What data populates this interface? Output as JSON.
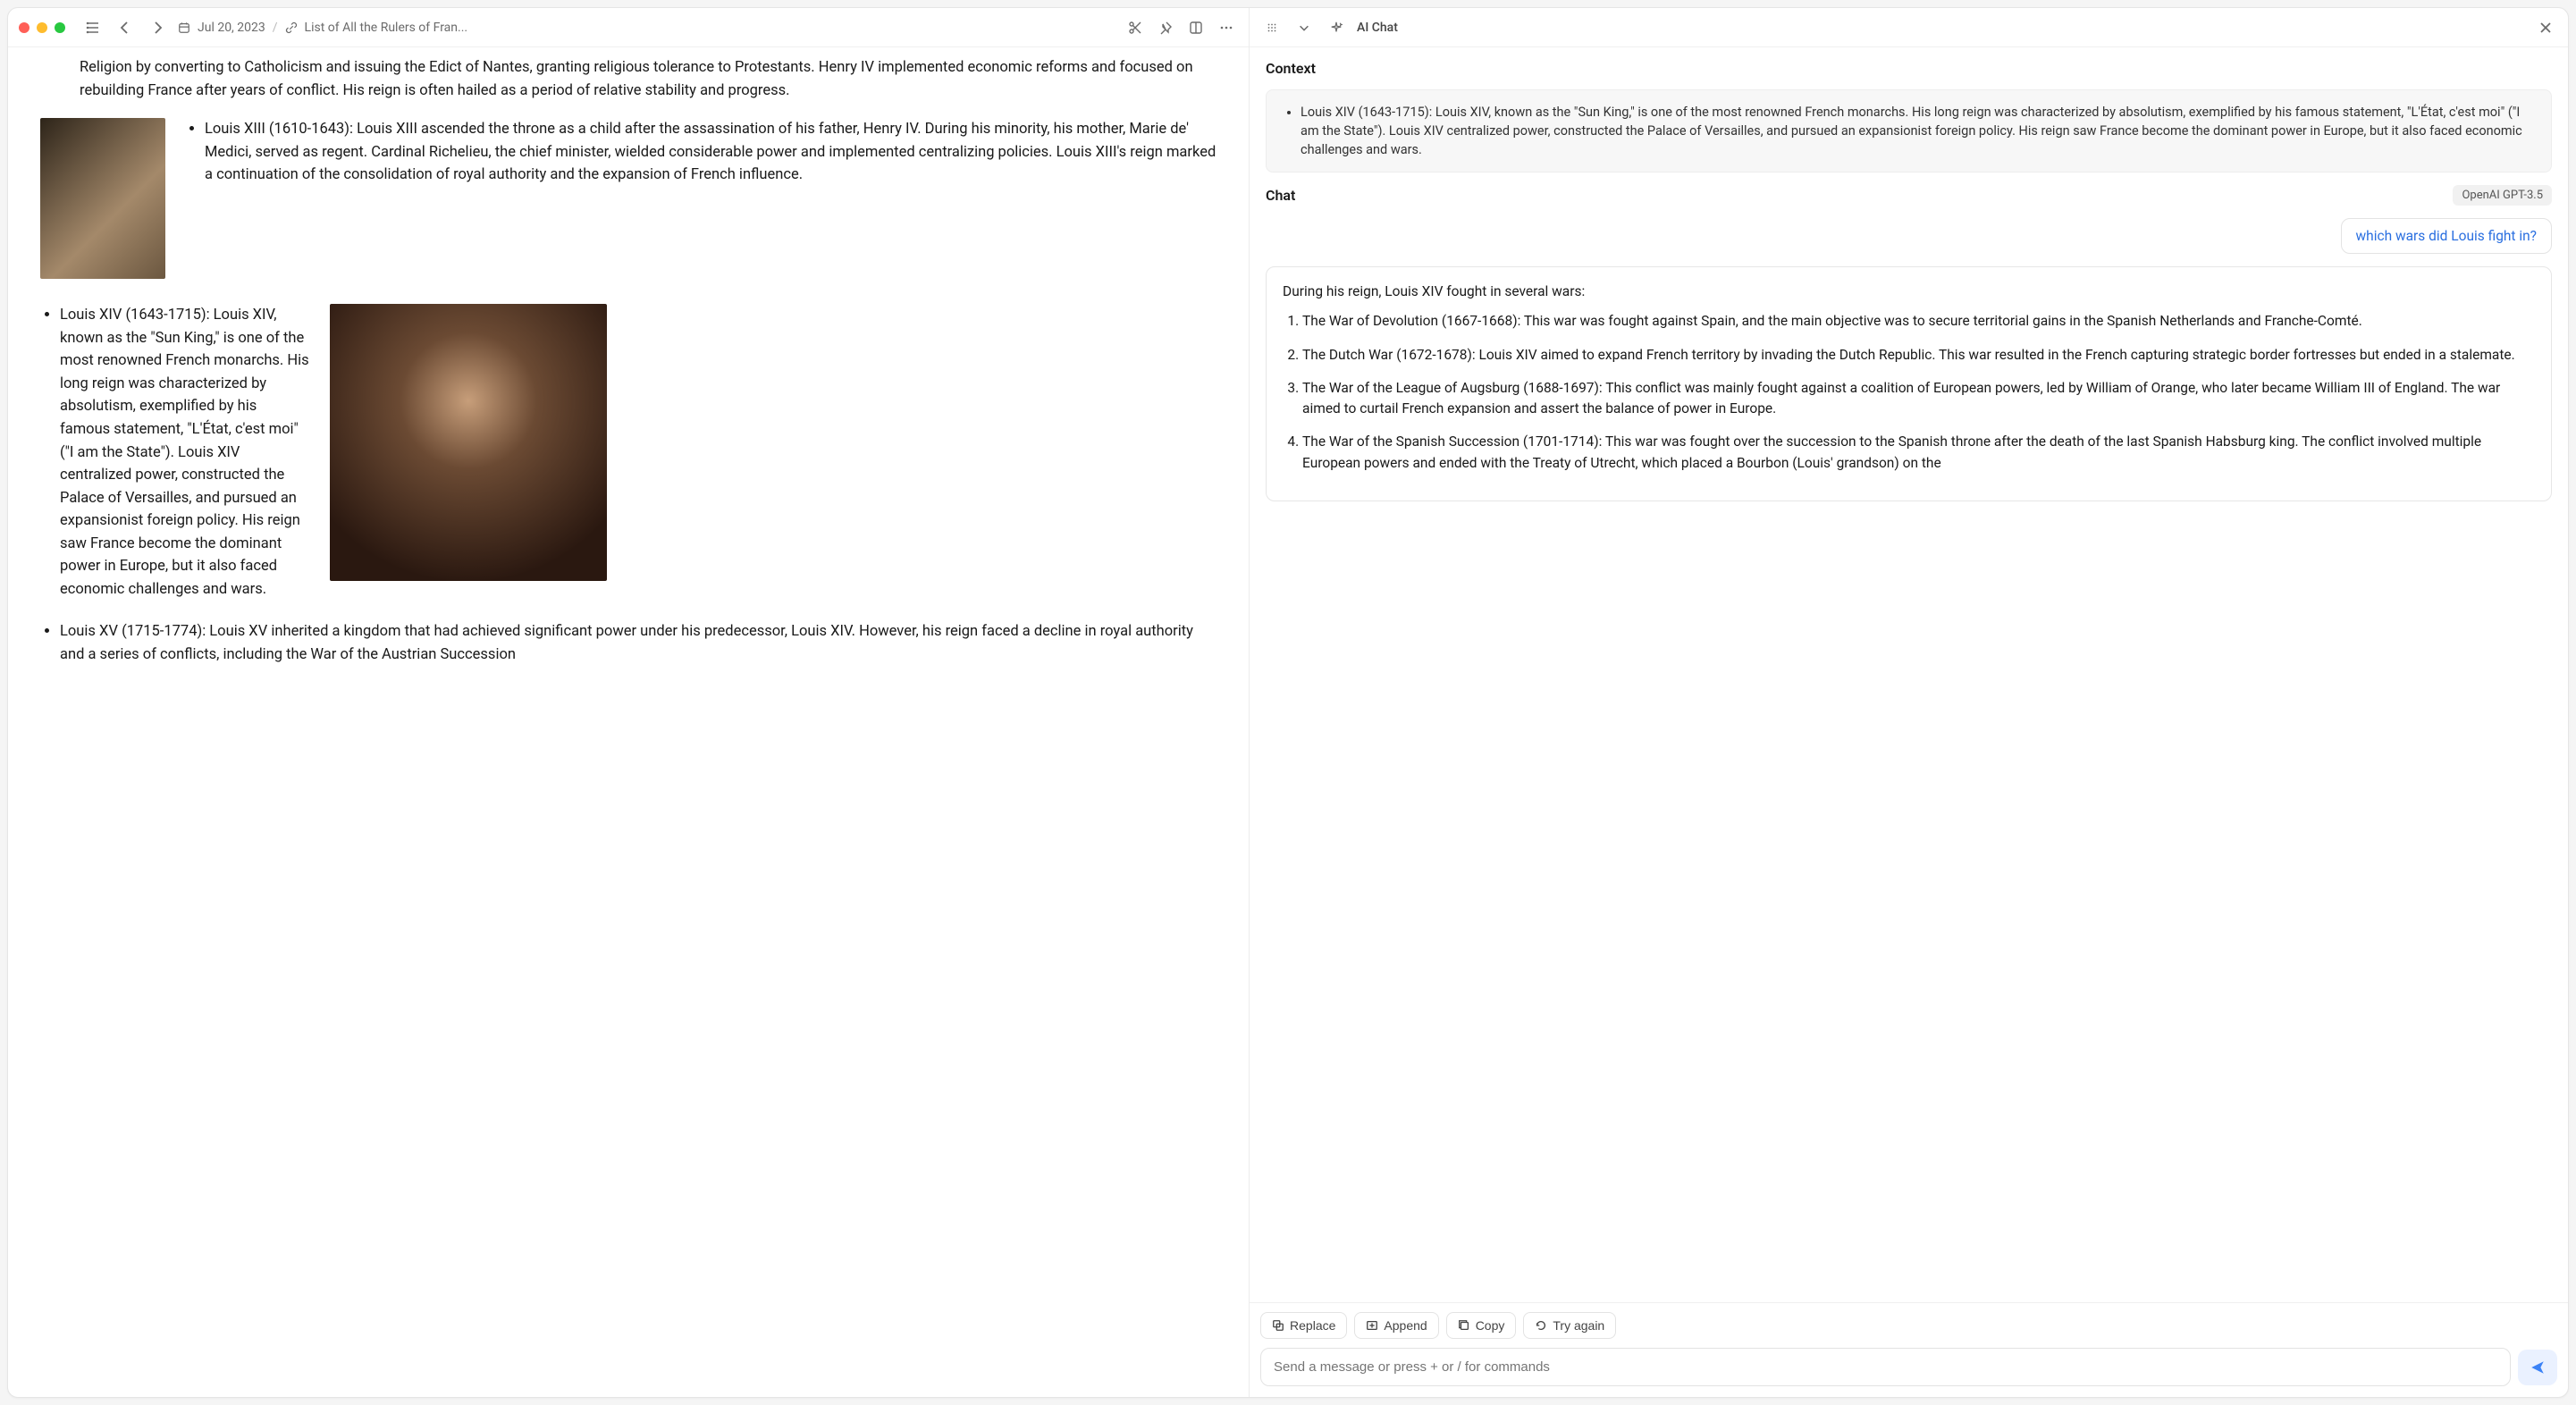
{
  "titlebar": {
    "date": "Jul 20, 2023",
    "doc_title": "List of All the Rulers of Fran..."
  },
  "document": {
    "intro_paragraph": "Religion by converting to Catholicism and issuing the Edict of Nantes, granting religious tolerance to Protestants. Henry IV implemented economic reforms and focused on rebuilding France after years of conflict. His reign is often hailed as a period of relative stability and progress.",
    "entries": {
      "louis_xiii": "Louis XIII (1610-1643): Louis XIII ascended the throne as a child after the assassination of his father, Henry IV. During his minority, his mother, Marie de' Medici, served as regent. Cardinal Richelieu, the chief minister, wielded considerable power and implemented centralizing policies. Louis XIII's reign marked a continuation of the consolidation of royal authority and the expansion of French influence.",
      "louis_xiv": "Louis XIV (1643-1715): Louis XIV, known as the \"Sun King,\" is one of the most renowned French monarchs. His long reign was characterized by absolutism, exemplified by his famous statement, \"L'État, c'est moi\" (\"I am the State\"). Louis XIV centralized power, constructed the Palace of Versailles, and pursued an expansionist foreign policy. His reign saw France become the dominant power in Europe, but it also faced economic challenges and wars.",
      "louis_xv": "Louis XV (1715-1774): Louis XV inherited a kingdom that had achieved significant power under his predecessor, Louis XIV. However, his reign faced a decline in royal authority and a series of conflicts, including the War of the Austrian Succession"
    }
  },
  "ai_panel": {
    "title": "AI Chat",
    "context_label": "Context",
    "context_text": "Louis XIV (1643-1715): Louis XIV, known as the \"Sun King,\" is one of the most renowned French monarchs. His long reign was characterized by absolutism, exemplified by his famous statement, \"L'État, c'est moi\" (\"I am the State\"). Louis XIV centralized power, constructed the Palace of Versailles, and pursued an expansionist foreign policy. His reign saw France become the dominant power in Europe, but it also faced economic challenges and wars.",
    "chat_label": "Chat",
    "model": "OpenAI GPT-3.5",
    "user_message": "which wars did Louis fight in?",
    "assistant_intro": "During his reign, Louis XIV fought in several wars:",
    "assistant_wars": [
      "The War of Devolution (1667-1668): This war was fought against Spain, and the main objective was to secure territorial gains in the Spanish Netherlands and Franche-Comté.",
      "The Dutch War (1672-1678): Louis XIV aimed to expand French territory by invading the Dutch Republic. This war resulted in the French capturing strategic border fortresses but ended in a stalemate.",
      "The War of the League of Augsburg (1688-1697): This conflict was mainly fought against a coalition of European powers, led by William of Orange, who later became William III of England. The war aimed to curtail French expansion and assert the balance of power in Europe.",
      "The War of the Spanish Succession (1701-1714): This war was fought over the succession to the Spanish throne after the death of the last Spanish Habsburg king. The conflict involved multiple European powers and ended with the Treaty of Utrecht, which placed a Bourbon (Louis' grandson) on the"
    ],
    "actions": {
      "replace": "Replace",
      "append": "Append",
      "copy": "Copy",
      "try_again": "Try again"
    },
    "compose_placeholder": "Send a message or press + or / for commands"
  }
}
